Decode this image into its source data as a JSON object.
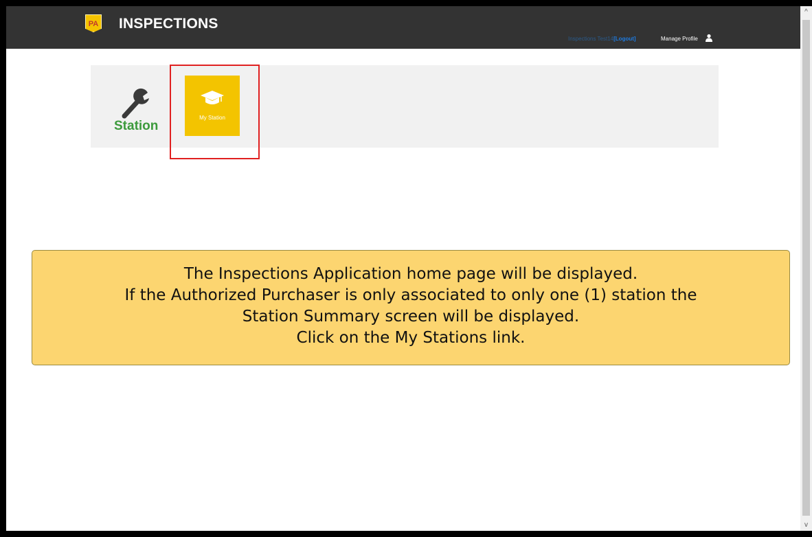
{
  "header": {
    "logo_text": "PA",
    "title": "INSPECTIONS",
    "user_name": "Inspections Test14",
    "logout_label": "[Logout]",
    "manage_profile": "Manage Profile",
    "user_icon": "user-icon"
  },
  "nav": {
    "station_label": "Station",
    "station_icon": "wrench-icon",
    "tile_label": "My Station",
    "tile_icon": "graduation-cap-icon",
    "tile_color": "#f3c400"
  },
  "callout": {
    "lines": [
      "The Inspections Application home page will be displayed.",
      "If the Authorized Purchaser is only associated to only one (1) station the",
      "Station Summary screen will be displayed.",
      "Click on the My Stations link."
    ],
    "background": "#fcd570"
  },
  "scrollbar": {
    "up_glyph": "^",
    "down_glyph": "v"
  }
}
